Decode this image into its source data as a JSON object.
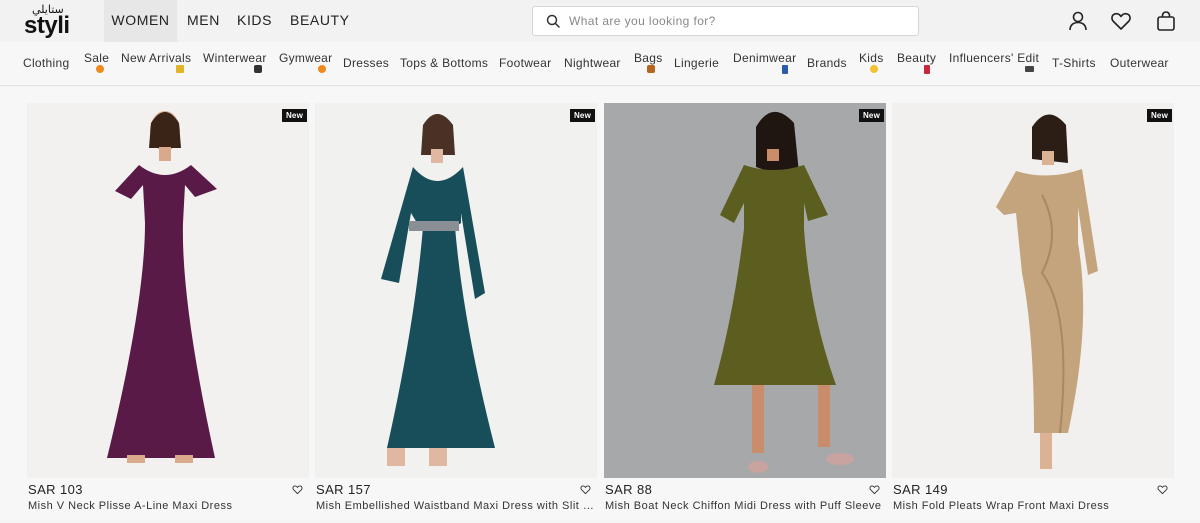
{
  "header": {
    "logo_ar": "ستايلي",
    "logo_en": "styli",
    "genders": [
      "WOMEN",
      "MEN",
      "KIDS",
      "BEAUTY"
    ],
    "active_gender": "WOMEN",
    "search_placeholder": "What are you looking for?"
  },
  "categories": [
    {
      "label": "Clothing"
    },
    {
      "label": "Sale",
      "icon": "fire-icon"
    },
    {
      "label": "New Arrivals",
      "icon": "sparkle-icon"
    },
    {
      "label": "Winterwear",
      "icon": "jacket-icon"
    },
    {
      "label": "Gymwear",
      "icon": "fire-icon"
    },
    {
      "label": "Dresses"
    },
    {
      "label": "Tops & Bottoms"
    },
    {
      "label": "Footwear"
    },
    {
      "label": "Nightwear"
    },
    {
      "label": "Bags",
      "icon": "bag-icon"
    },
    {
      "label": "Lingerie"
    },
    {
      "label": "Denimwear",
      "icon": "jeans-icon"
    },
    {
      "label": "Brands"
    },
    {
      "label": "Kids",
      "icon": "smiley-icon"
    },
    {
      "label": "Beauty",
      "icon": "lipstick-icon"
    },
    {
      "label": "Influencers' Edit",
      "icon": "camera-icon"
    },
    {
      "label": "T-Shirts"
    },
    {
      "label": "Outerwear"
    }
  ],
  "products": [
    {
      "badge": "New",
      "price": "SAR 103",
      "name": "Mish V Neck Plisse A-Line Maxi Dress",
      "color": "#5a1a47",
      "bg": "#f2f1f0"
    },
    {
      "badge": "New",
      "price": "SAR 157",
      "name": "Mish Embellished Waistband Maxi Dress with Slit Sleeves",
      "color": "#174e5a",
      "bg": "#f1f1f0"
    },
    {
      "badge": "New",
      "price": "SAR 88",
      "name": "Mish Boat Neck Chiffon Midi Dress with Puff Sleeve",
      "color": "#5b5e1e",
      "bg": "#a7a8aa"
    },
    {
      "badge": "New",
      "price": "SAR 149",
      "name": "Mish Fold Pleats Wrap Front Maxi Dress",
      "color": "#c4a47c",
      "bg": "#f1f0ef"
    }
  ]
}
